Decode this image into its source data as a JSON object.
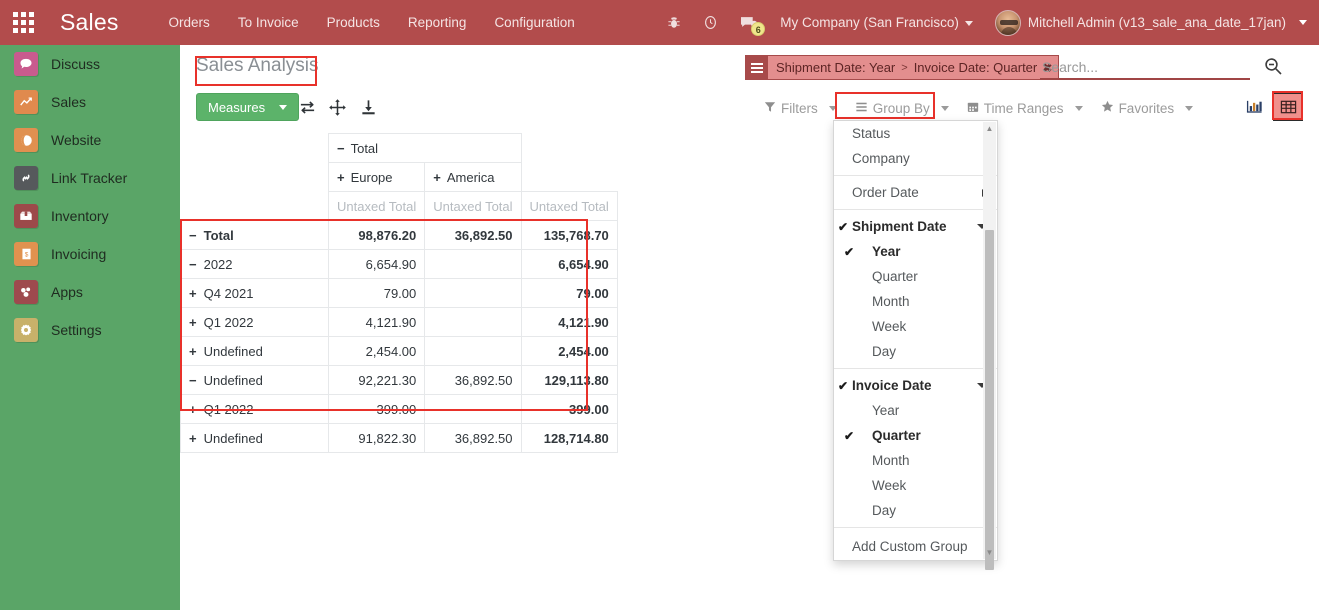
{
  "navbar": {
    "apps_icon": "apps-grid-icon",
    "brand": "Sales",
    "menu": [
      "Orders",
      "To Invoice",
      "Products",
      "Reporting",
      "Configuration"
    ],
    "bug_icon": "bug-icon",
    "clock_icon": "clock-icon",
    "messages_icon": "messages-icon",
    "messages_count": "6",
    "company": "My Company (San Francisco)",
    "user": "Mitchell Admin (v13_sale_ana_date_17jan)"
  },
  "sidebar": {
    "items": [
      {
        "label": "Discuss",
        "icon": "discuss-icon",
        "glyph": "●",
        "color": "#c95b8e"
      },
      {
        "label": "Sales",
        "icon": "sales-icon",
        "glyph": "↗",
        "color": "#e08a4e"
      },
      {
        "label": "Website",
        "icon": "website-icon",
        "glyph": "◕",
        "color": "#e09050"
      },
      {
        "label": "Link Tracker",
        "icon": "link-tracker-icon",
        "glyph": "⚭",
        "color": "#56595c"
      },
      {
        "label": "Inventory",
        "icon": "inventory-icon",
        "glyph": "▤",
        "color": "#9c4a4a"
      },
      {
        "label": "Invoicing",
        "icon": "invoicing-icon",
        "glyph": "$",
        "color": "#e0924f"
      },
      {
        "label": "Apps",
        "icon": "apps-icon",
        "glyph": "❖",
        "color": "#9e4a4e"
      },
      {
        "label": "Settings",
        "icon": "settings-icon",
        "glyph": "⚙",
        "color": "#c8b16a"
      }
    ]
  },
  "control_panel": {
    "page_title": "Sales Analysis",
    "measures_label": "Measures",
    "flip_axis_icon": "flip-axis-icon",
    "expand_all_icon": "expand-all-icon",
    "download_icon": "download-xlsx-icon",
    "facet": {
      "icon": "group-by-facet-icon",
      "part1": "Shipment Date: Year",
      "separator": ">",
      "part2": "Invoice Date: Quarter",
      "remove": "✖"
    },
    "search": {
      "value": "",
      "placeholder": "Search...",
      "icon": "search-zoom-out-icon"
    },
    "menus": [
      {
        "label": "Filters",
        "icon": "filter-icon"
      },
      {
        "label": "Group By",
        "icon": "group-by-icon"
      },
      {
        "label": "Time Ranges",
        "icon": "calendar-icon"
      },
      {
        "label": "Favorites",
        "icon": "star-icon"
      }
    ],
    "views": [
      {
        "name": "graph-view-button",
        "icon": "bar-chart-icon",
        "active": false
      },
      {
        "name": "pivot-view-button",
        "icon": "pivot-table-icon",
        "active": true
      }
    ]
  },
  "pivot": {
    "col_group_total": {
      "symbol": "−",
      "label": "Total"
    },
    "col_headers": [
      {
        "symbol": "+",
        "label": "Europe"
      },
      {
        "symbol": "+",
        "label": "America"
      }
    ],
    "measure_labels": [
      "Untaxed Total",
      "Untaxed Total",
      "Untaxed Total"
    ],
    "rows": [
      {
        "symbol": "−",
        "label": "Total",
        "indent": 0,
        "bold": true,
        "values": [
          "98,876.20",
          "36,892.50",
          "135,768.70"
        ]
      },
      {
        "symbol": "−",
        "label": "2022",
        "indent": 1,
        "bold": false,
        "values": [
          "6,654.90",
          "",
          "6,654.90"
        ]
      },
      {
        "symbol": "+",
        "label": "Q4 2021",
        "indent": 2,
        "bold": false,
        "values": [
          "79.00",
          "",
          "79.00"
        ]
      },
      {
        "symbol": "+",
        "label": "Q1 2022",
        "indent": 2,
        "bold": false,
        "values": [
          "4,121.90",
          "",
          "4,121.90"
        ]
      },
      {
        "symbol": "+",
        "label": "Undefined",
        "indent": 2,
        "bold": false,
        "values": [
          "2,454.00",
          "",
          "2,454.00"
        ]
      },
      {
        "symbol": "−",
        "label": "Undefined",
        "indent": 1,
        "bold": false,
        "values": [
          "92,221.30",
          "36,892.50",
          "129,113.80"
        ]
      },
      {
        "symbol": "+",
        "label": "Q1 2022",
        "indent": 2,
        "bold": false,
        "values": [
          "399.00",
          "",
          "399.00"
        ]
      },
      {
        "symbol": "+",
        "label": "Undefined",
        "indent": 2,
        "bold": false,
        "values": [
          "91,822.30",
          "36,892.50",
          "128,714.80"
        ]
      }
    ]
  },
  "group_by_dropdown": {
    "items": [
      {
        "label": "Status",
        "type": "plain"
      },
      {
        "label": "Company",
        "type": "plain"
      },
      {
        "type": "divider"
      },
      {
        "label": "Order Date",
        "type": "expandable",
        "arrow": "right"
      },
      {
        "label": "Shipment Date",
        "type": "group-header",
        "checked": true,
        "arrow": "down"
      },
      {
        "label": "Year",
        "type": "sub",
        "checked": true
      },
      {
        "label": "Quarter",
        "type": "sub",
        "checked": false
      },
      {
        "label": "Month",
        "type": "sub",
        "checked": false
      },
      {
        "label": "Week",
        "type": "sub",
        "checked": false
      },
      {
        "label": "Day",
        "type": "sub",
        "checked": false
      },
      {
        "type": "divider"
      },
      {
        "label": "Invoice Date",
        "type": "group-header",
        "checked": true,
        "arrow": "down"
      },
      {
        "label": "Year",
        "type": "sub",
        "checked": false
      },
      {
        "label": "Quarter",
        "type": "sub",
        "checked": true
      },
      {
        "label": "Month",
        "type": "sub",
        "checked": false
      },
      {
        "label": "Week",
        "type": "sub",
        "checked": false
      },
      {
        "label": "Day",
        "type": "sub",
        "checked": false
      },
      {
        "type": "divider"
      },
      {
        "label": "Add Custom Group",
        "type": "plain"
      }
    ],
    "check_glyph": "✔"
  },
  "annotations": {
    "color": "#e8312a",
    "boxes": [
      "page-title",
      "group-by-menu",
      "pivot-rows",
      "shipment-date-section",
      "invoice-date-section",
      "pivot-view-button"
    ]
  }
}
